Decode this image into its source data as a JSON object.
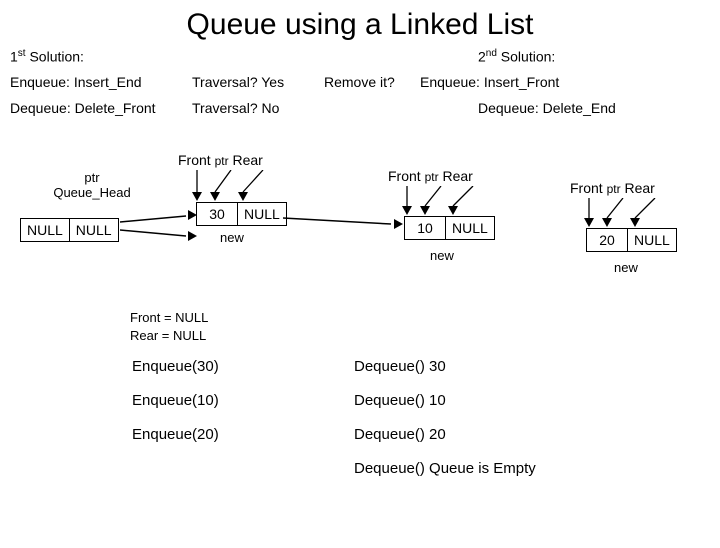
{
  "title": "Queue using a Linked List",
  "sol1": {
    "label": "1",
    "suffix": "st",
    "text": " Solution:"
  },
  "sol2": {
    "label": "2",
    "suffix": "nd",
    "text": " Solution:"
  },
  "enq1": "Enqueue: Insert_End",
  "trav1": "Traversal?  Yes",
  "remove": "Remove it?",
  "enq2": "Enqueue: Insert_Front",
  "deq1": "Dequeue: Delete_Front",
  "trav2": "Traversal?  No",
  "deq2": "Dequeue: Delete_End",
  "labels": {
    "front": "Front",
    "rear": "Rear",
    "ptr": "ptr",
    "queue_head": "Queue_Head",
    "null": "NULL",
    "new": "new"
  },
  "node1": {
    "val": "30",
    "next": "NULL"
  },
  "node2": {
    "val": "10",
    "next": "NULL"
  },
  "node3": {
    "val": "20",
    "next": "NULL"
  },
  "init": {
    "front": "Front = NULL",
    "rear": "Rear = NULL"
  },
  "ops": {
    "enq": [
      "Enqueue(30)",
      "Enqueue(10)",
      "Enqueue(20)"
    ],
    "deq": [
      "Dequeue()  30",
      "Dequeue()  10",
      "Dequeue()  20",
      "Dequeue()  Queue is Empty"
    ]
  }
}
